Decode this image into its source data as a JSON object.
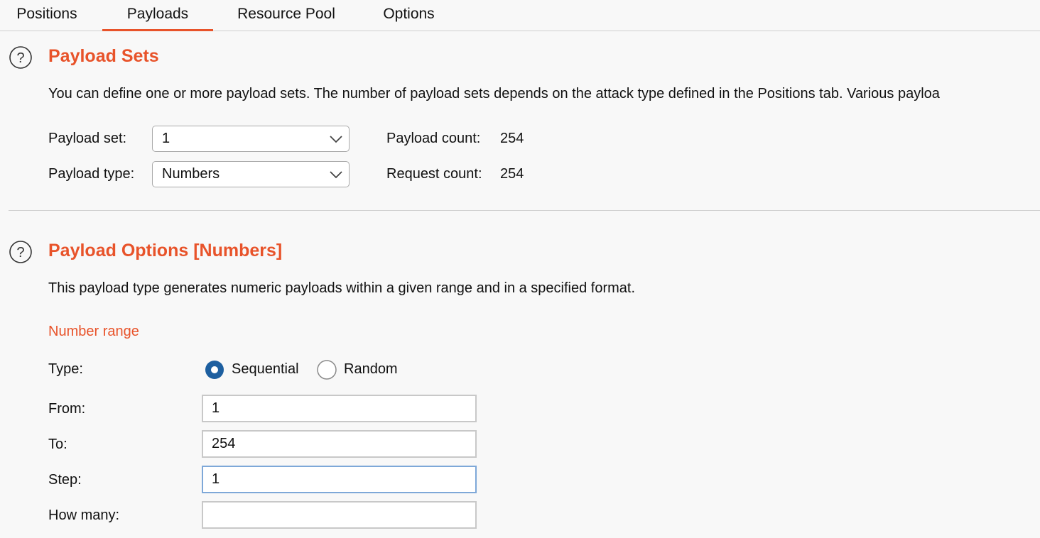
{
  "tabs": [
    {
      "label": "Positions",
      "active": false
    },
    {
      "label": "Payloads",
      "active": true
    },
    {
      "label": "Resource Pool",
      "active": false
    },
    {
      "label": "Options",
      "active": false
    }
  ],
  "payload_sets": {
    "title": "Payload Sets",
    "description": "You can define one or more payload sets. The number of payload sets depends on the attack type defined in the Positions tab. Various payloa",
    "payload_set_label": "Payload set:",
    "payload_set_value": "1",
    "payload_type_label": "Payload type:",
    "payload_type_value": "Numbers",
    "payload_count_label": "Payload count:",
    "payload_count_value": "254",
    "request_count_label": "Request count:",
    "request_count_value": "254"
  },
  "payload_options": {
    "title": "Payload Options [Numbers]",
    "description": "This payload type generates numeric payloads within a given range and in a specified format.",
    "number_range_heading": "Number range",
    "type_label": "Type:",
    "type_options": [
      {
        "label": "Sequential",
        "selected": true
      },
      {
        "label": "Random",
        "selected": false
      }
    ],
    "from_label": "From:",
    "from_value": "1",
    "to_label": "To:",
    "to_value": "254",
    "step_label": "Step:",
    "step_value": "1",
    "how_many_label": "How many:",
    "how_many_value": ""
  },
  "colors": {
    "accent": "#e8532a",
    "radio_selected": "#1d5fa0",
    "focus_border": "#7ea8d8"
  },
  "icons": {
    "help": "help-circle-icon",
    "dropdown": "chevron-down-icon"
  }
}
